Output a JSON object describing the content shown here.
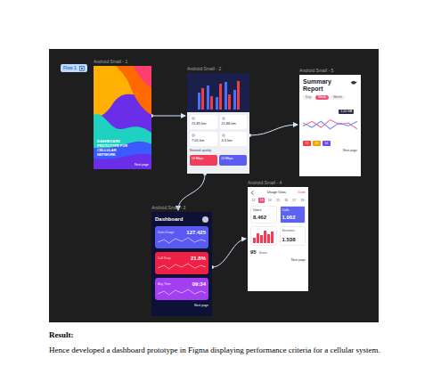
{
  "canvas": {
    "flow": "Flow 1",
    "frames": [
      {
        "kind": "splash",
        "label": "Android Small - 1",
        "title": "DASHBOARD PROTOTYPE FOR CELLULAR NETWORK",
        "button": "Next page"
      },
      {
        "kind": "overview",
        "label": "Android Small - 2",
        "chart": {
          "series": [
            {
              "values": [
                55,
                80,
                40,
                90,
                65
              ],
              "color": "#4c6ef5"
            },
            {
              "values": [
                70,
                45,
                85,
                50,
                95
              ],
              "color": "#f03e3e"
            }
          ]
        },
        "cards": [
          {
            "value": "21.85 km"
          },
          {
            "value": "21.86 km"
          },
          {
            "value": "7.05 km"
          },
          {
            "value": "4.3 km"
          }
        ],
        "section": "Network quality",
        "tiles": [
          {
            "value": "18 Mbps",
            "color": "#f03e5a"
          },
          {
            "value": "24 Mbps",
            "color": "#5c5cf0"
          }
        ]
      },
      {
        "kind": "summary",
        "label": "Android Small - 5",
        "title": "Summary Report",
        "tabs": [
          {
            "label": "Day",
            "selected": false
          },
          {
            "label": "Week",
            "selected": true
          },
          {
            "label": "Month",
            "selected": false
          }
        ],
        "chart": {
          "series": [
            {
              "values": [
                40,
                55,
                35,
                60,
                45,
                50,
                30
              ],
              "color": "#f06595"
            },
            {
              "values": [
                50,
                35,
                55,
                30,
                50,
                40,
                55
              ],
              "color": "#748ffc"
            }
          ],
          "tooltip": "1.24 GB"
        },
        "tiles": [
          {
            "value": "72",
            "color": "#f03e3e"
          },
          {
            "value": "48",
            "color": "#f59f00"
          },
          {
            "value": "31",
            "color": "#7048e8"
          }
        ],
        "button": "Next page"
      },
      {
        "kind": "dashboard",
        "label": "Android Small - 3",
        "title": "Dashboard",
        "cards": [
          {
            "label": "Data Usage",
            "value": "127.425",
            "color": "#5a5af2"
          },
          {
            "label": "Call Drop",
            "value": "21.8%",
            "color": "#f01f45"
          },
          {
            "label": "Avg Time",
            "value": "09:34",
            "color": "#a23ff0"
          }
        ],
        "button": "Next page"
      },
      {
        "kind": "stats",
        "label": "Android Small - 4",
        "title": "Usage Data",
        "action": "Date",
        "days": [
          {
            "label": "12",
            "selected": false
          },
          {
            "label": "13",
            "selected": true
          },
          {
            "label": "14",
            "selected": false
          },
          {
            "label": "15",
            "selected": false
          },
          {
            "label": "16",
            "selected": false
          },
          {
            "label": "17",
            "selected": false
          },
          {
            "label": "18",
            "selected": false
          }
        ],
        "metrics": [
          {
            "label": "Users",
            "value": "8.462",
            "highlight": false
          },
          {
            "label": "Calls",
            "value": "1.062",
            "highlight": true
          }
        ],
        "bars": {
          "values": [
            40,
            70,
            55,
            90,
            60,
            80
          ]
        },
        "extra": [
          {
            "label": "Sessions",
            "value": "1.538"
          },
          {
            "label": "Score",
            "value": "95"
          }
        ],
        "button": "Next page"
      }
    ]
  },
  "result": {
    "heading": "Result:",
    "text": "Hence developed a dashboard prototype in Figma displaying performance criteria for a cellular system."
  }
}
